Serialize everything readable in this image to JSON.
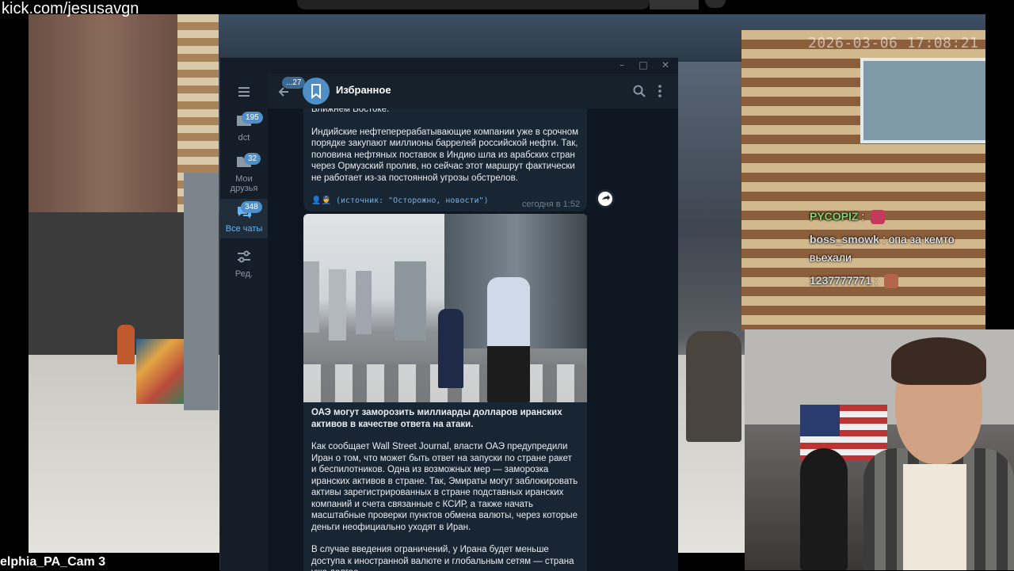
{
  "stream": {
    "url": "kick.com/jesusavgn",
    "camera_timestamp": "2026-03-06 17:08:21",
    "camera_label": "elphia_PA_Cam 3"
  },
  "chat": [
    {
      "user": "PYCOPIZ",
      "text": ":",
      "user_color": "#7fd36b"
    },
    {
      "user": "boss_smowk",
      "text": ": опа за кемто",
      "continuation": "вьехали",
      "user_color": "#d9d9d9"
    },
    {
      "user": "1237777771",
      "text": ":",
      "user_color": "#d9d9d9"
    }
  ],
  "telegram": {
    "header_title": "Избранное",
    "back_badge": "...27",
    "sidebar": [
      {
        "label": "dct",
        "badge": "195",
        "icon": "folder-icon"
      },
      {
        "label": "Мои друзья",
        "badge": "32",
        "icon": "folder-icon"
      },
      {
        "label": "Все чаты",
        "badge": "348",
        "icon": "chats-icon",
        "active": true
      },
      {
        "label": "Ред.",
        "badge": "",
        "icon": "filters-edit-icon"
      }
    ],
    "message1": {
      "top_line": "Ближнем Востоке.",
      "paragraph": "Индийские нефтеперерабатывающие компании уже в срочном порядке закупают миллионы баррелей российской нефти. Так, половина нефтяных поставок в Индию шла из арабских стран через Ормузский пролив, но сейчас этот маршрут фактически не работает из-за постоянной угрозы обстрелов.",
      "source": "(источник: \"Осторожно, новости\")",
      "time": "сегодня в 1:52"
    },
    "message2": {
      "headline": "ОАЭ могут заморозить миллиарды долларов иранских активов в качестве ответа на атаки.",
      "paragraph1": "Как сообщает Wall Street Journal, власти ОАЭ предупредили Иран о том, что может быть ответ на запуски по стране ракет и беспилотников. Одна из возможных мер — заморозка иранских активов в стране. Так, Эмираты могут заблокировать активы зарегистрированных в стране подставных иранских компаний и счета связанные с КСИР, а также начать масштабные проверки пунктов обмена валюты, через которые деньги неофициально уходят в Иран.",
      "paragraph2": "В случае введения ограничений, у Ирана будет меньше доступа к иностранной валюте и глобальным сетям — страна уже долгое"
    }
  },
  "colors": {
    "accent": "#6ab3f3",
    "badge": "#4f8ec7",
    "bubble": "#182533",
    "window_bg": "#0e1621"
  }
}
